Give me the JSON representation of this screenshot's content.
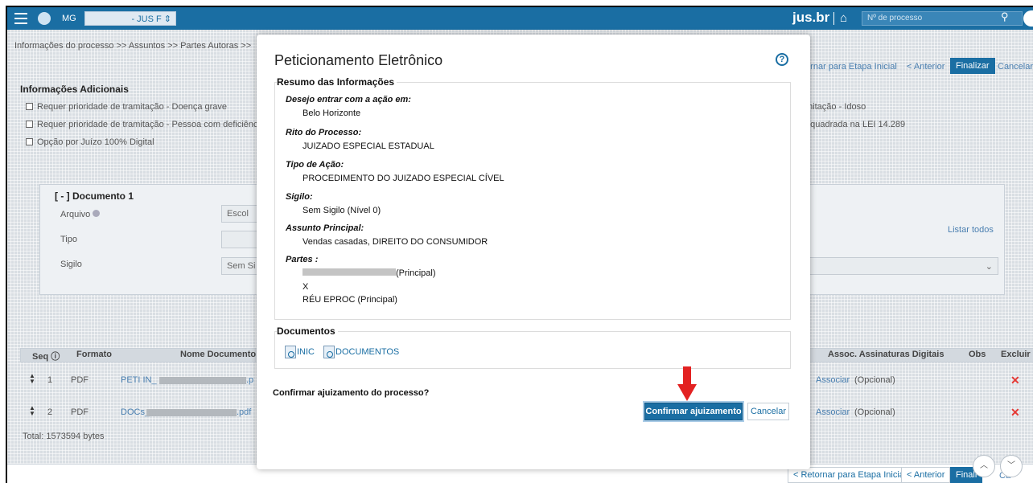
{
  "topbar": {
    "state": "MG",
    "unit_select": "- JUS F",
    "brand": "jus.br",
    "search_placeholder": "Nº de processo"
  },
  "background": {
    "breadcrumb": "Informações do processo  >>  Assuntos  >>  Partes Autoras  >>",
    "nav_buttons": {
      "retornar": "tornar para Etapa Inicial",
      "anterior": "< Anterior",
      "finalizar": "Finalizar",
      "cancelar": "Cancelar"
    },
    "info_title": "Informações Adicionais",
    "checkboxes": [
      "Requer prioridade de tramitação - Doença grave",
      "Requer prioridade de tramitação - Pessoa com deficiência",
      "Opção por Juízo 100% Digital"
    ],
    "right_checkbox_texts": [
      "mitação - Idoso",
      "nquadrada na LEI 14.289"
    ],
    "document_title": "[ - ] Documento 1",
    "doc_labels": {
      "arquivo": "Arquivo",
      "tipo": "Tipo",
      "sigilo": "Sigilo"
    },
    "escolher": "Escol",
    "sigilo_value": "Sem Si",
    "listar_todos": "Listar todos",
    "table_headers": {
      "seq": "Seq",
      "formato": "Formato",
      "nome": "Nome Documento",
      "assoc": "Assoc. Assinaturas Digitais",
      "obs": "Obs",
      "excluir": "Excluir"
    },
    "rows": [
      {
        "seq": "1",
        "formato": "PDF",
        "nome_prefix": "PETI IN_",
        "nome_suffix": ".p",
        "assoc_link": "Associar",
        "assoc_note": "(Opcional)"
      },
      {
        "seq": "2",
        "formato": "PDF",
        "nome_prefix": "DOCs_",
        "nome_suffix": ".pdf",
        "assoc_link": "Associar",
        "assoc_note": "(Opcional)"
      }
    ],
    "total": "Total: 1573594 bytes",
    "bottom_nav": {
      "retornar": "< Retornar para Etapa Inicial",
      "anterior": "< Anterior",
      "finalizar": "Finali",
      "cancelar": "Ca"
    }
  },
  "modal": {
    "title": "Peticionamento Eletrônico",
    "summary_legend": "Resumo das Informações",
    "summary": [
      {
        "label": "Desejo entrar com a ação em:",
        "value": "Belo Horizonte"
      },
      {
        "label": "Rito do Processo:",
        "value": "JUIZADO ESPECIAL ESTADUAL"
      },
      {
        "label": "Tipo de Ação:",
        "value": "PROCEDIMENTO DO JUIZADO ESPECIAL CÍVEL"
      },
      {
        "label": "Sigilo:",
        "value": "Sem Sigilo (Nível 0)"
      },
      {
        "label": "Assunto Principal:",
        "value": "Vendas casadas, DIREITO DO CONSUMIDOR"
      }
    ],
    "partes_label": "Partes :",
    "partes": {
      "autor_suffix": "(Principal)",
      "versus": "X",
      "reu": "RÉU EPROC (Principal)"
    },
    "documents_legend": "Documentos",
    "documents": [
      "INIC",
      "DOCUMENTOS"
    ],
    "confirm_question": "Confirmar ajuizamento do processo?",
    "confirm_button": "Confirmar ajuizamento",
    "cancel_button": "Cancelar"
  },
  "colors": {
    "primary": "#1a6ea3",
    "arrow": "#e32222"
  }
}
